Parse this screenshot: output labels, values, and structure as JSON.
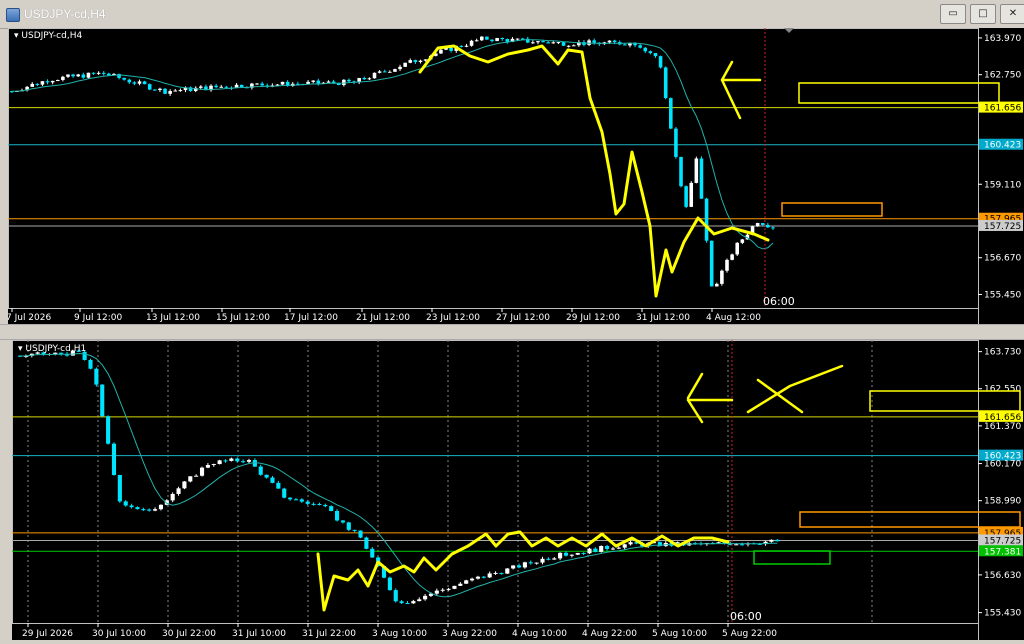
{
  "window": {
    "title": "USDJPY-cd,H4",
    "btn_min": "▭",
    "btn_restore": "□",
    "btn_close": "✕"
  },
  "colors": {
    "bull": "#ffffff",
    "bear": "#00e5ff",
    "ma": "#20b2aa",
    "yellow": "#ffff00",
    "orange": "#ff9900",
    "cyan_line": "#1ab5c8",
    "green": "#00cc00",
    "axis_text": "#ffffff"
  },
  "charts": [
    {
      "id": "h4",
      "label": "USDJPY-cd,H4",
      "price_min": 155.0,
      "price_max": 164.3,
      "price_ticks": [
        "163.970",
        "162.750",
        "161.656",
        "160.423",
        "159.110",
        "157.965",
        "157.725",
        "156.670",
        "155.450"
      ],
      "time_ticks": [
        "7 Jul 2026",
        "9 Jul 12:00",
        "13 Jul 12:00",
        "15 Jul 12:00",
        "17 Jul 12:00",
        "21 Jul 12:00",
        "23 Jul 12:00",
        "27 Jul 12:00",
        "29 Jul 12:00",
        "31 Jul 12:00",
        "4 Aug 12:00"
      ],
      "cursor_time": "06:00",
      "levels": {
        "yellow": "161.656",
        "cyan": "160.423",
        "orange": "157.965",
        "gray": "157.725"
      }
    },
    {
      "id": "h1",
      "label": "USDJPY-cd,H1",
      "price_min": 155.1,
      "price_max": 164.1,
      "price_ticks": [
        "163.730",
        "162.550",
        "161.656",
        "161.370",
        "160.423",
        "160.170",
        "158.990",
        "157.965",
        "157.725",
        "157.381",
        "156.630",
        "155.430"
      ],
      "time_ticks": [
        "29 Jul 2026",
        "30 Jul 10:00",
        "30 Jul 22:00",
        "31 Jul 10:00",
        "31 Jul 22:00",
        "3 Aug 10:00",
        "3 Aug 22:00",
        "4 Aug 10:00",
        "4 Aug 22:00",
        "5 Aug 10:00",
        "5 Aug 22:00"
      ],
      "cursor_time": "06:00",
      "levels": {
        "yellow": "161.656",
        "cyan": "160.423",
        "orange": "157.965",
        "gray": "157.725",
        "green": "157.381"
      }
    }
  ]
}
